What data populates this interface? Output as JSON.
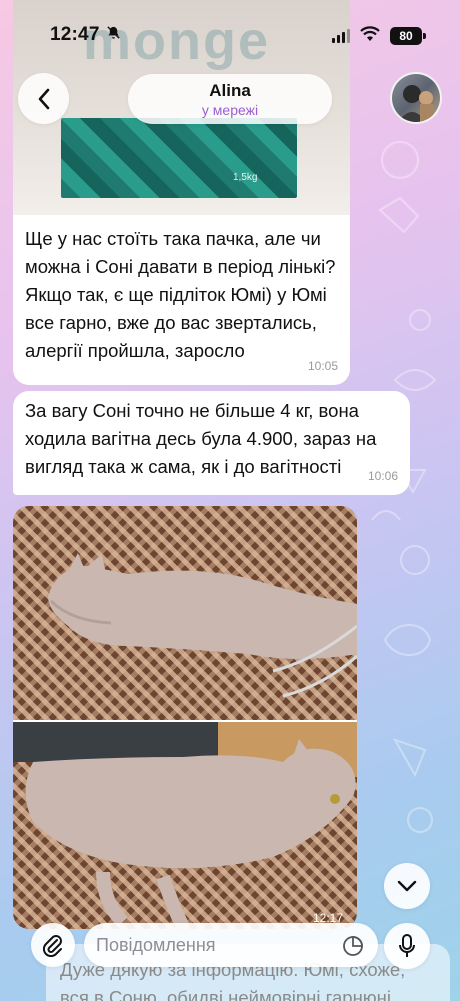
{
  "status_bar": {
    "time": "12:47",
    "battery": "80",
    "icons": [
      "bell-slash-icon",
      "signal-icon",
      "wifi-icon",
      "battery-icon"
    ]
  },
  "header": {
    "back_icon": "chevron-left-icon",
    "contact_name": "Alina",
    "contact_status": "у мережі"
  },
  "messages": [
    {
      "type": "photo-with-caption",
      "photo_text": "monge",
      "pack_text": "1,5kg",
      "text": "Ще у нас стоїть така пачка, але чи можна і Соні давати в період лінькі? Якщо так, є ще підліток Юмі) у Юмі все гарно, вже до вас звертались, алергії пройшла, заросло",
      "time": "10:05"
    },
    {
      "type": "text",
      "text": "За вагу Соні  точно не більше 4 кг, вона ходила вагітна десь була 4.900, зараз на вигляд така ж сама, як і до вагітності",
      "time": "10:06"
    },
    {
      "type": "album",
      "photos": [
        "cat-photo-top",
        "cat-photo-side"
      ],
      "time": "12:17"
    },
    {
      "type": "text-partial",
      "text": "Дуже дякую за інформацію. Юмі, схоже, вся в Соню, обидві неймовірні гарнюні"
    }
  ],
  "input_bar": {
    "placeholder": "Повідомлення",
    "attach_icon": "paperclip-icon",
    "sticker_icon": "sticker-icon",
    "mic_icon": "microphone-icon",
    "scroll_icon": "chevron-down-icon"
  },
  "colors": {
    "accent": "#9a5fd0",
    "bubble": "#ffffff",
    "wallpaper_top": "#f6c9e4",
    "wallpaper_bottom": "#9ed3ea"
  }
}
